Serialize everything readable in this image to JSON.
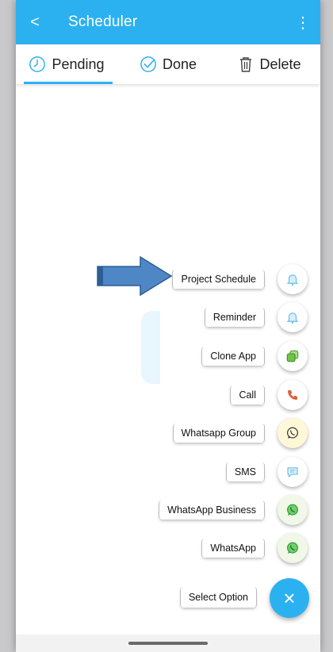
{
  "app": {
    "title": "Scheduler"
  },
  "appbar": {
    "back_glyph": "<",
    "menu_glyph": "⋮"
  },
  "tabs": [
    {
      "label": "Pending",
      "icon": "clock-icon",
      "active": true
    },
    {
      "label": "Done",
      "icon": "check-circle-icon",
      "active": false
    },
    {
      "label": "Delete",
      "icon": "trash-icon",
      "active": false
    }
  ],
  "options": [
    {
      "label": "Project Schedule",
      "icon": "bell-icon",
      "color": "#6fbfe8"
    },
    {
      "label": "Reminder",
      "icon": "bell-icon",
      "color": "#6fbfe8"
    },
    {
      "label": "Clone App",
      "icon": "clone-icon",
      "color": "#6fc44a"
    },
    {
      "label": "Call",
      "icon": "phone-icon",
      "color": "#e0603a"
    },
    {
      "label": "Whatsapp Group",
      "icon": "whatsapp-icon",
      "color": "#333333"
    },
    {
      "label": "SMS",
      "icon": "message-icon",
      "color": "#6fbfe8"
    },
    {
      "label": "WhatsApp Business",
      "icon": "whatsapp-icon",
      "color": "#2a9d3e"
    },
    {
      "label": "WhatsApp",
      "icon": "whatsapp-icon",
      "color": "#2a9d3e"
    }
  ],
  "fab": {
    "label": "Select Option",
    "glyph": "×"
  },
  "colors": {
    "primary": "#2cb1f0",
    "arrow": "#4f86c6"
  }
}
